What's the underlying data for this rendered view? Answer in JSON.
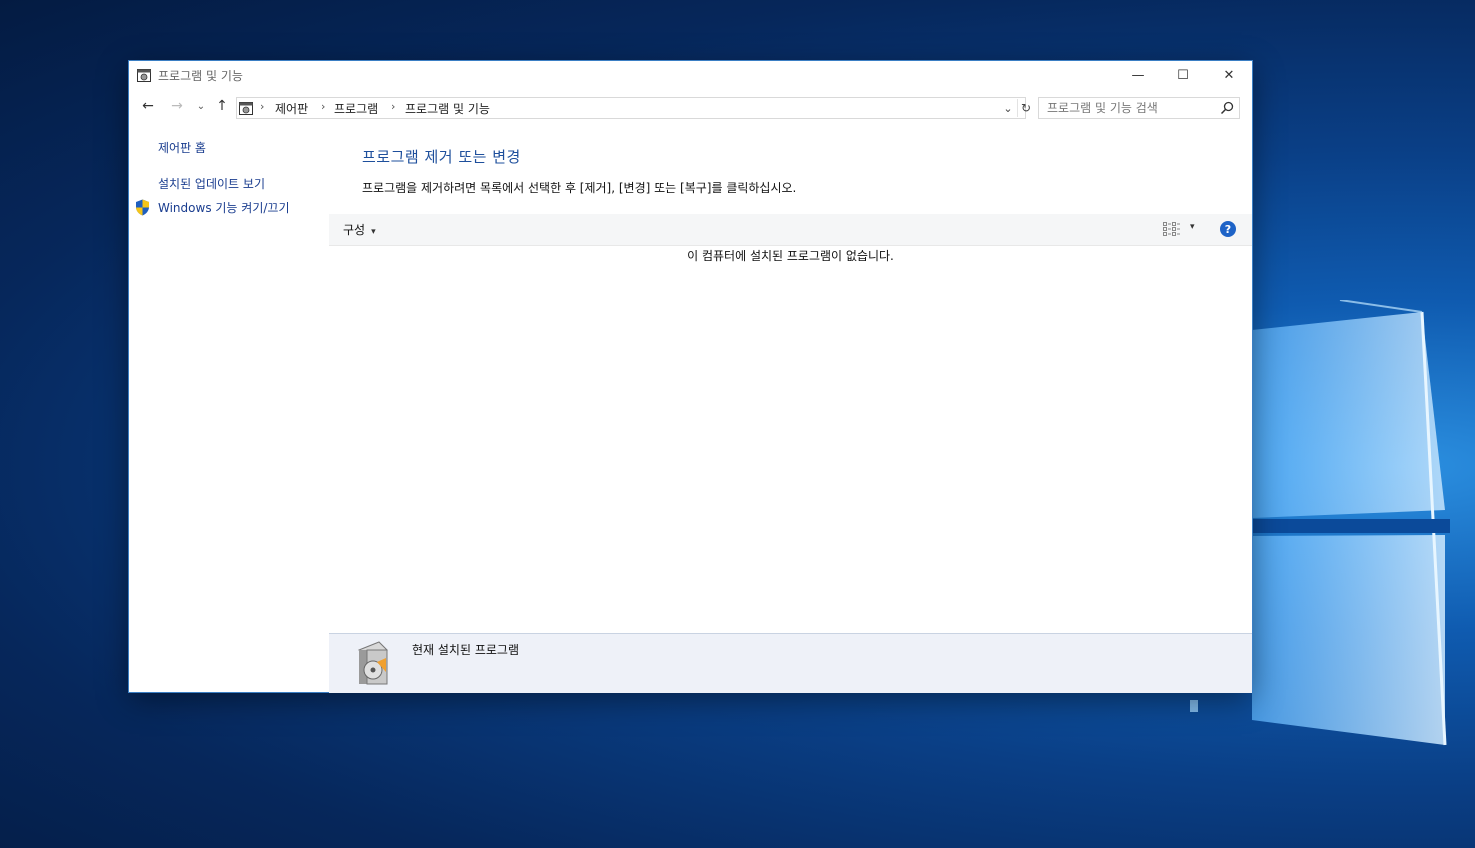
{
  "window": {
    "title": "프로그램 및 기능",
    "controls": {
      "minimize": "—",
      "maximize": "☐",
      "close": "✕"
    }
  },
  "nav": {
    "back": "←",
    "forward": "→",
    "recent": "⌄",
    "up": "↑",
    "breadcrumb": [
      "제어판",
      "프로그램",
      "프로그램 및 기능"
    ],
    "separator": "›",
    "dropdown": "⌄",
    "refresh": "↻"
  },
  "search": {
    "placeholder": "프로그램 및 기능 검색",
    "value": ""
  },
  "sidebar": {
    "items": [
      {
        "label": "제어판 홈"
      },
      {
        "label": "설치된 업데이트 보기"
      },
      {
        "label": "Windows 기능 켜기/끄기",
        "icon": "shield-icon"
      }
    ]
  },
  "main": {
    "title": "프로그램 제거 또는 변경",
    "description": "프로그램을 제거하려면 목록에서 선택한 후 [제거], [변경] 또는 [복구]를 클릭하십시오.",
    "toolbar": {
      "organize_label": "구성",
      "caret": "▾",
      "view_caret": "▾",
      "help": "?"
    },
    "empty_message": "이 컴퓨터에 설치된 프로그램이 없습니다."
  },
  "details": {
    "label": "현재 설치된 프로그램"
  },
  "colors": {
    "link": "#1a3d8f",
    "title": "#1e4f9c",
    "help": "#1e63c7",
    "accent_border": "#3b7fc4"
  }
}
